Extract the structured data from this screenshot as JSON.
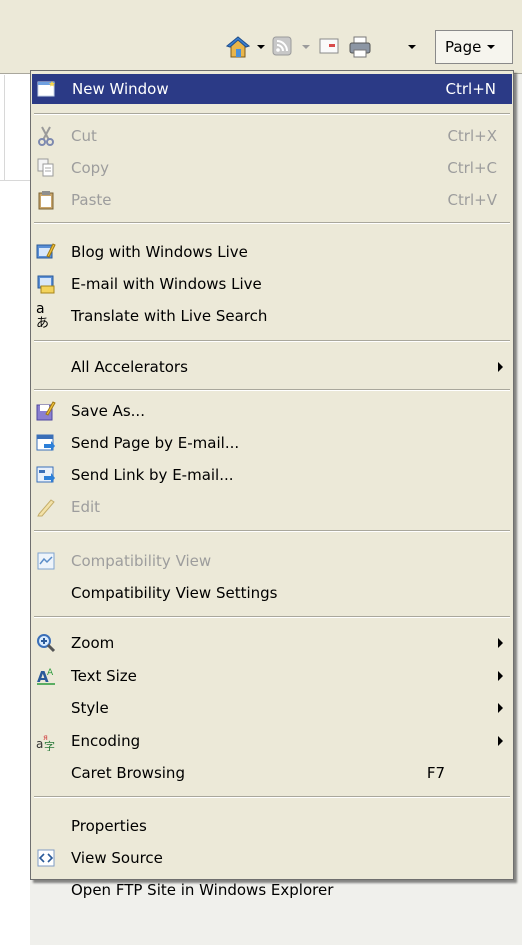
{
  "toolbar": {
    "icons": [
      "home-icon",
      "feeds-icon",
      "read-mail-icon",
      "print-icon"
    ],
    "page_button_label": "Page"
  },
  "menu": {
    "items": {
      "new_window": {
        "label": "New Window",
        "shortcut": "Ctrl+N",
        "icon": "new-window-icon",
        "enabled": true,
        "highlighted": true
      },
      "cut": {
        "label": "Cut",
        "shortcut": "Ctrl+X",
        "icon": "scissors-icon",
        "enabled": false
      },
      "copy": {
        "label": "Copy",
        "shortcut": "Ctrl+C",
        "icon": "copy-icon",
        "enabled": false
      },
      "paste": {
        "label": "Paste",
        "shortcut": "Ctrl+V",
        "icon": "clipboard-icon",
        "enabled": false
      },
      "blog": {
        "label": "Blog with Windows Live",
        "icon": "blog-icon",
        "enabled": true
      },
      "email_live": {
        "label": "E-mail with Windows Live",
        "icon": "email-live-icon",
        "enabled": true
      },
      "translate": {
        "label": "Translate with Live Search",
        "icon": "translate-icon",
        "enabled": true
      },
      "accelerators": {
        "label": "All Accelerators",
        "enabled": true,
        "submenu": true
      },
      "save_as": {
        "label": "Save As...",
        "icon": "save-icon",
        "enabled": true
      },
      "send_page": {
        "label": "Send Page by E-mail...",
        "icon": "send-page-icon",
        "enabled": true
      },
      "send_link": {
        "label": "Send Link by E-mail...",
        "icon": "send-link-icon",
        "enabled": true
      },
      "edit": {
        "label": "Edit",
        "icon": "pencil-icon",
        "enabled": false
      },
      "compat_view": {
        "label": "Compatibility View",
        "icon": "compatibility-view-icon",
        "enabled": false
      },
      "compat_settings": {
        "label": "Compatibility View Settings",
        "enabled": true
      },
      "zoom": {
        "label": "Zoom",
        "icon": "zoom-icon",
        "enabled": true,
        "submenu": true
      },
      "text_size": {
        "label": "Text Size",
        "icon": "text-size-icon",
        "enabled": true,
        "submenu": true
      },
      "style": {
        "label": "Style",
        "enabled": true,
        "submenu": true
      },
      "encoding": {
        "label": "Encoding",
        "icon": "encoding-icon",
        "enabled": true,
        "submenu": true
      },
      "caret": {
        "label": "Caret Browsing",
        "shortcut": "F7",
        "enabled": true
      },
      "properties": {
        "label": "Properties",
        "enabled": true
      },
      "view_source": {
        "label": "View Source",
        "icon": "view-source-icon",
        "enabled": true
      },
      "open_ftp": {
        "label": "Open FTP Site in Windows Explorer",
        "enabled": true
      }
    }
  },
  "colors": {
    "menu_bg": "#ece9d8",
    "highlight": "#2b3a86",
    "disabled_text": "#9d9d9d"
  }
}
